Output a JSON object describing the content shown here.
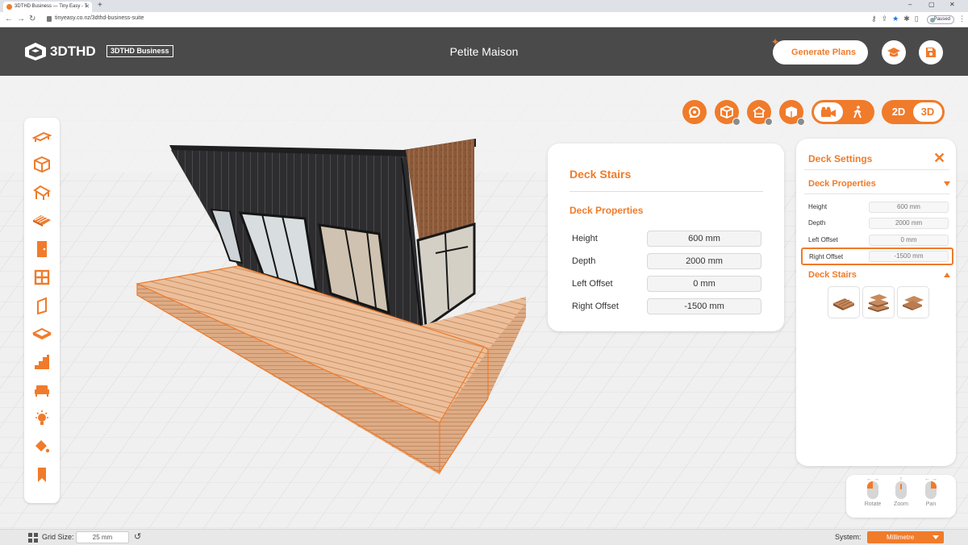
{
  "browser": {
    "tab_title": "3DTHD Business — Tiny Easy - T",
    "new_tab": "+",
    "url": "tinyeasy.co.nz/3dthd-business-suite",
    "profile_status": "Paused",
    "window_controls": [
      "–",
      "▢",
      "✕"
    ]
  },
  "header": {
    "logo_text": "3DTHD",
    "logo_badge": "3DTHD Business",
    "project_title": "Petite Maison",
    "generate_label": "Generate Plans",
    "icons": [
      "graduation-cap-icon",
      "save-icon"
    ]
  },
  "view_tools": {
    "mode_2d": "2D",
    "mode_3d": "3D",
    "active_mode": "3D"
  },
  "popup": {
    "title": "Deck Stairs",
    "section": "Deck Properties",
    "rows": [
      {
        "label": "Height",
        "value": "600 mm"
      },
      {
        "label": "Depth",
        "value": "2000 mm"
      },
      {
        "label": "Left Offset",
        "value": "0 mm"
      },
      {
        "label": "Right Offset",
        "value": "-1500 mm"
      }
    ]
  },
  "settings": {
    "title": "Deck Settings",
    "properties_section": "Deck Properties",
    "rows": [
      {
        "label": "Height",
        "value": "600 mm"
      },
      {
        "label": "Depth",
        "value": "2000 mm"
      },
      {
        "label": "Left Offset",
        "value": "0 mm"
      },
      {
        "label": "Right Offset",
        "value": "-1500 mm"
      }
    ],
    "stairs_section": "Deck Stairs"
  },
  "mouse_hints": [
    {
      "label": "Rotate",
      "arrow": "← →"
    },
    {
      "label": "Zoom",
      "arrow": "↑"
    },
    {
      "label": "Pan",
      "arrow": "← →"
    }
  ],
  "status": {
    "grid_label": "Grid Size:",
    "grid_value": "25 mm",
    "system_label": "System:",
    "system_value": "Millimetre"
  },
  "colors": {
    "accent": "#f07b2a",
    "header_bg": "#4a4a4a",
    "cladding": "#2b2b2e",
    "deck": "#e8b48c"
  }
}
